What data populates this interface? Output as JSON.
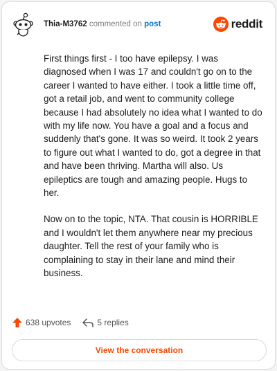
{
  "header": {
    "username": "Thia-M3762",
    "action_text": "commented on",
    "post_link": "post",
    "brand_name": "reddit",
    "brand_color": "#ff4500"
  },
  "comment": {
    "paragraphs": [
      "First things first - I too have epilepsy. I was diagnosed when I was 17 and couldn't go on to the career I wanted to have either. I took a little time off, got a retail job, and went to community college because I had absolutely no idea what I wanted to do with my life now. You have a goal and a focus and suddenly that's gone. It was so weird. It took 2 years to figure out what I wanted to do, got a degree in that and have been thriving. Martha will also. Us epileptics are tough and amazing people. Hugs to her.",
      "Now on to the topic, NTA. That cousin is HORRIBLE and I wouldn't let them anywhere near my precious daughter. Tell the rest of your family who is complaining to stay in their lane and mind their business."
    ]
  },
  "footer": {
    "upvotes": "638 upvotes",
    "replies": "5 replies",
    "upvote_icon": "upvote-arrow-icon",
    "reply_icon": "reply-arrow-icon"
  },
  "cta": {
    "label": "View the conversation"
  }
}
